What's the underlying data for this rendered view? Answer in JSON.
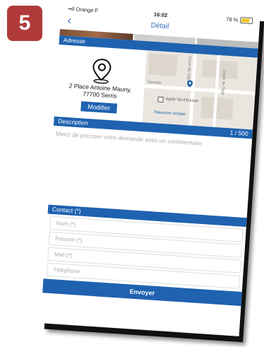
{
  "step_number": "5",
  "status_bar": {
    "carrier": "••ll Orange F",
    "time": "16:02",
    "battery_text": "78 %",
    "battery_level": 0.78
  },
  "nav": {
    "back_icon": "chevron-left-icon",
    "title": "Détail"
  },
  "address_section": {
    "label": "Adresse",
    "icon": "location-pin-icon",
    "line1": "2 Place Antoine Mauny,",
    "line2": "77700 Serris",
    "modify_label": "Modifier",
    "map_labels": [
      "Cours du Danube",
      "Danube",
      "Cours du Tage",
      "Apple Val d'Europe",
      "Matamore Simpler"
    ]
  },
  "description_section": {
    "label": "Description",
    "counter": "1 / 500",
    "placeholder": "Merci de préciser votre demande avec un commentaire"
  },
  "contact_section": {
    "label": "Contact (*)",
    "fields": {
      "nom": "Nom (*)",
      "prenom": "Prénom (*)",
      "mail": "Mail (*)",
      "telephone": "Téléphone"
    },
    "send_label": "Envoyer"
  },
  "colors": {
    "accent": "#1f62b0",
    "badge": "#b13a3a",
    "link": "#2a6db5"
  }
}
